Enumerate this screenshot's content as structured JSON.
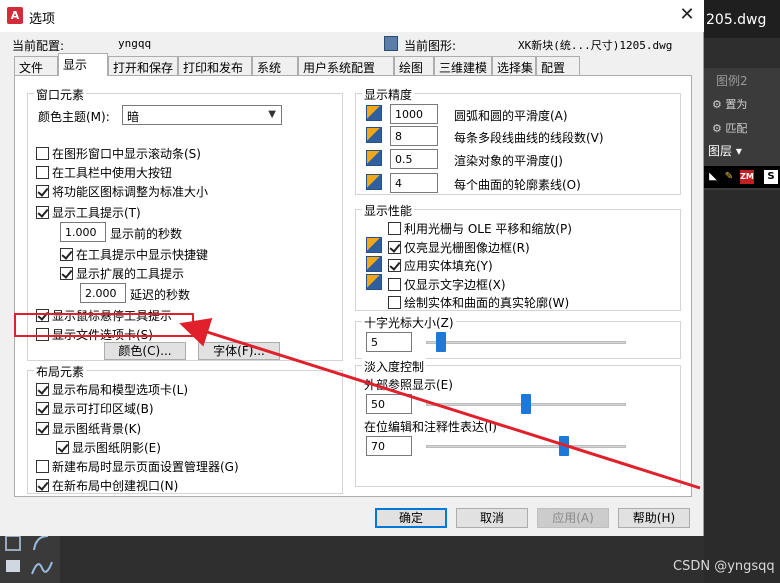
{
  "dialog": {
    "title": "选项",
    "close_glyph": "✕",
    "profile_label": "当前配置:",
    "profile_value": "yngqq",
    "drawing_label": "当前图形:",
    "drawing_value": "XK新块(统...尺寸)1205.dwg"
  },
  "tabs": [
    "文件",
    "显示",
    "打开和保存",
    "打印和发布",
    "系统",
    "用户系统配置",
    "绘图",
    "三维建模",
    "选择集",
    "配置"
  ],
  "active_tab": "显示",
  "window_elements": {
    "legend": "窗口元素",
    "color_scheme_label": "颜色主题(M):",
    "color_scheme_value": "暗",
    "show_scrollbars": "在图形窗口中显示滚动条(S)",
    "large_buttons": "在工具栏中使用大按钮",
    "resize_ribbon_icons": "将功能区图标调整为标准大小",
    "show_tooltips": "显示工具提示(T)",
    "tooltip_delay_value": "1.000",
    "tooltip_delay_label": "显示前的秒数",
    "show_shortcut_keys": "在工具提示中显示快捷键",
    "show_extended_tooltips": "显示扩展的工具提示",
    "extended_delay_value": "2.000",
    "extended_delay_label": "延迟的秒数",
    "rollover_tooltips": "显示鼠标悬停工具提示",
    "file_tabs": "显示文件选项卡(S)",
    "colors_button": "颜色(C)...",
    "fonts_button": "字体(F)..."
  },
  "layout_elements": {
    "legend": "布局元素",
    "layout_model_tabs": "显示布局和模型选项卡(L)",
    "printable_area": "显示可打印区域(B)",
    "paper_background": "显示图纸背景(K)",
    "paper_shadow": "显示图纸阴影(E)",
    "page_setup_manager": "新建布局时显示页面设置管理器(G)",
    "create_viewport": "在新布局中创建视口(N)"
  },
  "display_resolution": {
    "legend": "显示精度",
    "arc_smoothness_value": "1000",
    "arc_smoothness_label": "圆弧和圆的平滑度(A)",
    "polyline_segments_value": "8",
    "polyline_segments_label": "每条多段线曲线的线段数(V)",
    "rendered_smoothness_value": "0.5",
    "rendered_smoothness_label": "渲染对象的平滑度(J)",
    "contour_lines_value": "4",
    "contour_lines_label": "每个曲面的轮廓素线(O)"
  },
  "display_performance": {
    "legend": "显示性能",
    "pan_zoom_ole": "利用光栅与 OLE 平移和缩放(P)",
    "highlight_raster_frame": "仅亮显光栅图像边框(R)",
    "apply_solid_fill": "应用实体填充(Y)",
    "text_boundary_frame": "仅显示文字边框(X)",
    "true_silhouettes": "绘制实体和曲面的真实轮廓(W)"
  },
  "crosshair": {
    "legend": "十字光标大小(Z)",
    "value": "5",
    "level": 5
  },
  "fade_control": {
    "legend": "淡入度控制",
    "xref_label": "外部参照显示(E)",
    "xref_value": "50",
    "xref_level": 50,
    "inplace_label": "在位编辑和注释性表达(I)",
    "inplace_value": "70",
    "inplace_level": 70
  },
  "buttons": {
    "ok": "确定",
    "cancel": "取消",
    "apply": "应用(A)",
    "help": "帮助(H)"
  },
  "background_app": {
    "file_name": "205.dwg",
    "layer_label": "图例2",
    "row1": "⚙ 置为",
    "row2": "⚙ 匹配",
    "layer_dropdown": "图层 ▾",
    "watermark": "CSDN @yngsqq"
  },
  "colors": {
    "highlight": "#e0202a",
    "slider_thumb": "#1e78d7",
    "default_button_border": "#0078d7"
  }
}
